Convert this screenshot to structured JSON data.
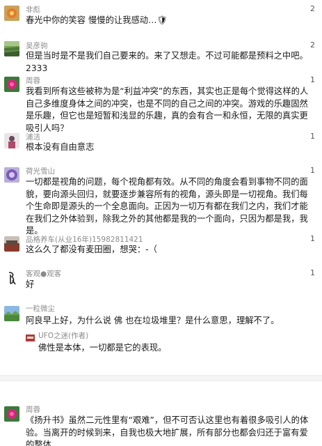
{
  "comments": [
    {
      "user": "非彪",
      "likes": "2",
      "text": "春光中你的笑容 慢慢的让我感动…🛡"
    },
    {
      "user": "吴彦驹",
      "likes": "2",
      "text": "但是当时是不是我们自己要来的。来了又想走。不过可能都是预料之中吧。2333"
    },
    {
      "user": "周蓉",
      "likes": "1",
      "text": "我看到所有这些被称为是“利益冲突”的东西，其实也正是每个觉得这样的人自己多维度身体之间的冲突，也是不同的自己之间的冲突。游戏的乐趣固然是乐趣，但它也是短暂和浅显的乐趣，真的会有合一和永恒，无限的真实更吸引人吗？"
    },
    {
      "user": "浦洁",
      "likes": "1",
      "text": "根本没有自由意志"
    },
    {
      "user": "荷光雪山",
      "likes": "1",
      "text": "一切都是视角的问题，每个视角都有效。从不同的角度会看到事物不同的面貌，要向源头回归，就要逐步兼容所有的视角，源头即是一切视角。我们每个生命即是源头的一个全息面向。正因为一切万有都在我们之内，我们才能在我们之外体验到，除我之外的其他都是我的一个面向，只因为都是我，我是。"
    },
    {
      "user": "品格养车(从业16年)15982811421",
      "likes": "1",
      "text": "这么久了都没有麦田圈，想哭：-（"
    },
    {
      "user": "客观●观客",
      "likes": "1",
      "text": "好"
    },
    {
      "user": "一粒微尘",
      "likes": "",
      "text": "阿良早上好，为什么说 佛 也在垃圾堆里？是什么意思，理解不了。",
      "reply": {
        "user": "UFO之迷(作者)",
        "text": "佛性是本体，一切都是它的表现。"
      }
    },
    {
      "user": "周蓉",
      "likes": "",
      "text": "《扬升书》虽然二元性里有“艰难”，但不可否认这里也有着很多吸引人的体验。当离开的时候到来，自我也极大地扩展，所有部分也都会归还于富有爱的整体"
    }
  ],
  "colors": {
    "username": "#8a8a8a",
    "text": "#1a1a1a",
    "divider": "#f4f4f4"
  }
}
